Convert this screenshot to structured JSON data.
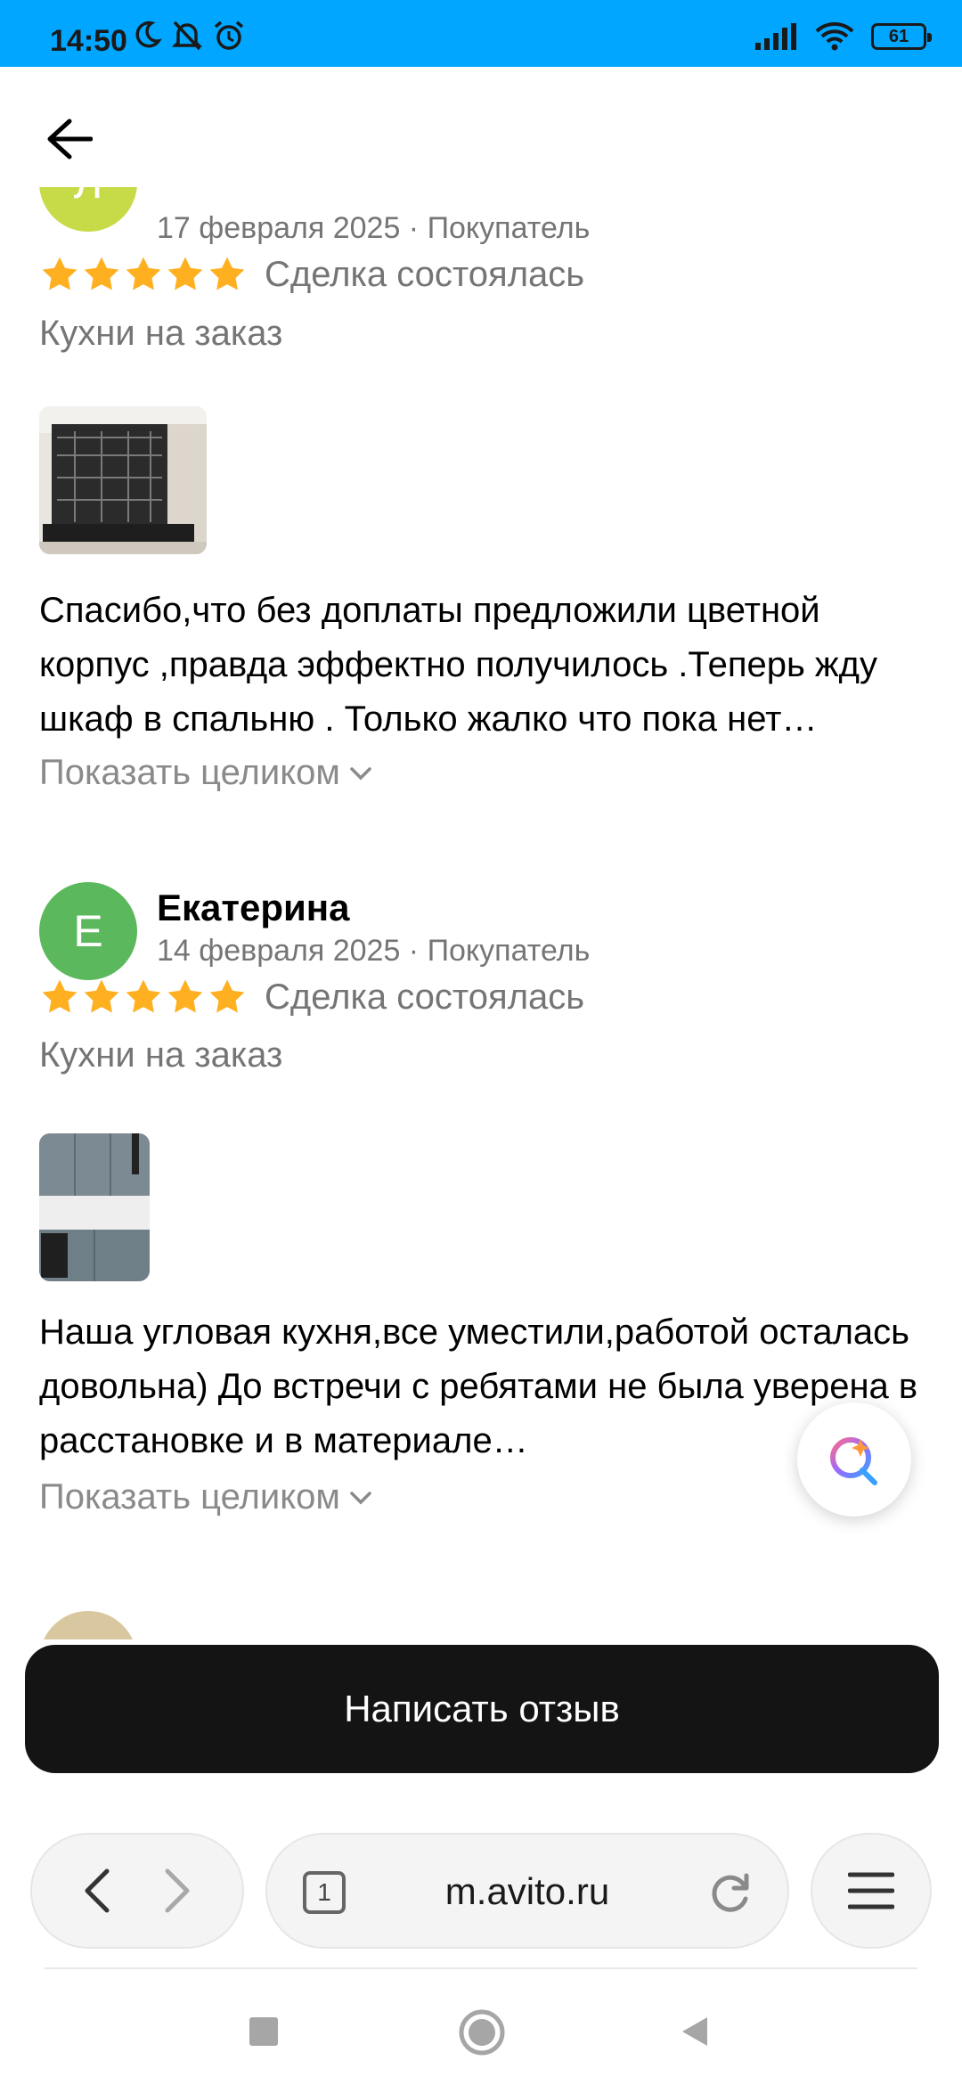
{
  "status_bar": {
    "time": "14:50",
    "battery": "61",
    "icons_left": [
      "moon-icon",
      "muted-bell-icon",
      "alarm-icon"
    ],
    "icons_right": [
      "signal-icon",
      "wifi-icon",
      "battery-icon"
    ]
  },
  "header": {
    "back_icon": "arrow-left-icon"
  },
  "reviews": [
    {
      "avatar_letter": "Л",
      "avatar_color": "#c7db48",
      "author": "",
      "meta": "17 февраля 2025 · Покупатель",
      "rating": 5,
      "deal_status": "Сделка состоялась",
      "category": "Кухни на заказ",
      "text": "Спасибо,что без доплаты предложили цветной корпус ,правда эффектно получилось .Теперь жду шкаф в спальню . Только жалко что пока нет…",
      "show_more": "Показать целиком"
    },
    {
      "avatar_letter": "Е",
      "avatar_color": "#5cb85c",
      "author": "Екатерина",
      "meta": "14 февраля 2025 · Покупатель",
      "rating": 5,
      "deal_status": "Сделка состоялась",
      "category": "Кухни на заказ",
      "text": "Наша угловая кухня,все уместили,работой осталась довольна) До встречи с ребятами не была уверена в расстановке и в материале…",
      "show_more": "Показать целиком"
    }
  ],
  "write_review_button": "Написать отзыв",
  "browser": {
    "tab_count": "1",
    "url": "m.avito.ru"
  },
  "colors": {
    "accent_star": "#ffb021",
    "status_bar": "#00a6ff",
    "primary_button": "#141414"
  }
}
